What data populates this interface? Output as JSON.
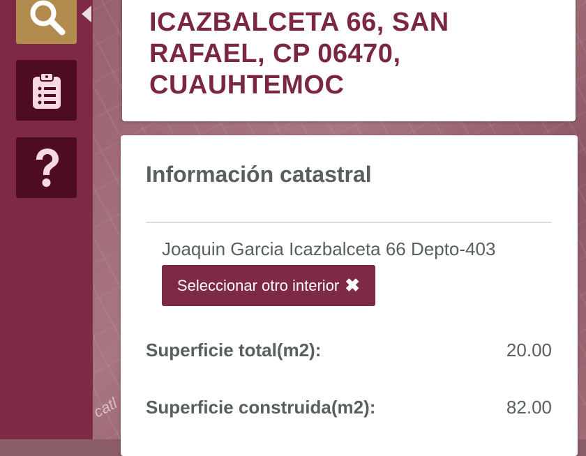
{
  "colors": {
    "sidebar": "#7e2a44",
    "accent_search": "#b28b4e",
    "button_dark": "#4e0c24",
    "title": "#7b2741",
    "text": "#57605e"
  },
  "sidebar": {
    "buttons": [
      {
        "icon": "search-icon"
      },
      {
        "icon": "clipboard-list-icon"
      },
      {
        "icon": "question-icon"
      }
    ]
  },
  "map": {
    "street_label": "catl"
  },
  "address": {
    "text": "ICAZBALCETA 66, SAN RAFAEL, CP 06470, CUAUHTEMOC"
  },
  "info": {
    "title": "Información catastral",
    "unit_name": "Joaquin Garcia Icazbalceta 66 Depto-403",
    "select_button": "Seleccionar otro interior",
    "select_icon": "✖",
    "rows": [
      {
        "label": "Superficie total(m2):",
        "value": "20.00"
      },
      {
        "label": "Superficie construida(m2):",
        "value": "82.00"
      }
    ]
  }
}
